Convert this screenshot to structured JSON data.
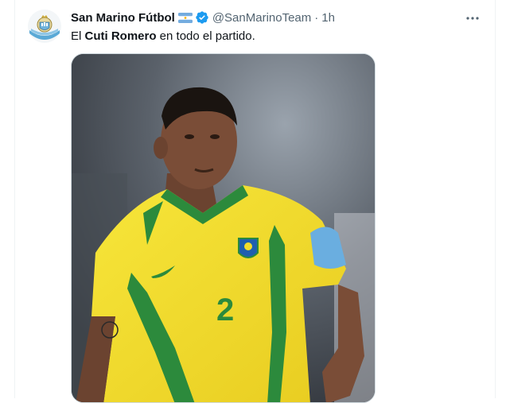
{
  "tweet": {
    "display_name": "San Marino Fútbol",
    "handle": "@SanMarinoTeam",
    "separator": "·",
    "time": "1h",
    "text_before": "El ",
    "text_bold": "Cuti Romero",
    "text_after": " en todo el partido."
  },
  "icons": {
    "avatar": "san-marino-crest",
    "flag": "argentina-flag-emoji",
    "verified": "verified-badge-icon",
    "more": "more-options-icon"
  },
  "media": {
    "description_icon": "football-player-photo",
    "shirt_number": "2"
  },
  "colors": {
    "verified": "#1d9bf0",
    "secondary_text": "#536471",
    "shirt_yellow": "#f3de2c",
    "shirt_green": "#2c8a3c"
  }
}
